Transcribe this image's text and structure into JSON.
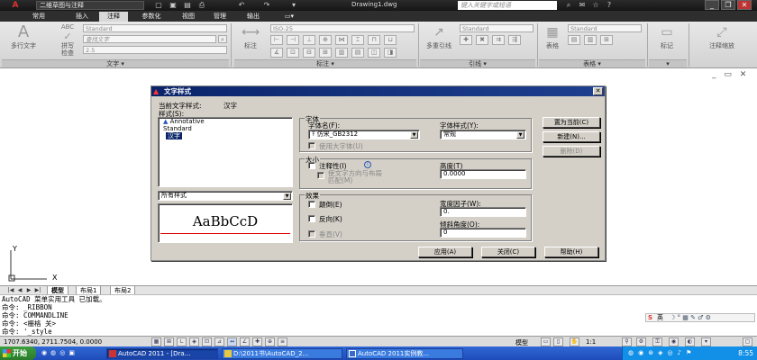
{
  "titlebar": {
    "app_button": "A",
    "workspace": "二维草图与注释",
    "quick_access": [
      "▢",
      "▣",
      "▤",
      "⎙",
      "↶",
      "↷",
      "▾"
    ],
    "document_title": "Drawing1.dwg",
    "search_placeholder": "键入关键字或短语",
    "window_controls": [
      "_",
      "❐",
      "✕"
    ]
  },
  "ribbon_tabs": [
    "常用",
    "插入",
    "注释",
    "参数化",
    "视图",
    "管理",
    "输出",
    "▭▾"
  ],
  "ribbon_active_tab": "注释",
  "ribbon": {
    "text_panel": {
      "big_button": "多行文字",
      "abc_label": "ABC",
      "spell_check": "拼写\n检查",
      "style_combo": "Standard",
      "find_text": "查找文字",
      "height_combo": "2.5",
      "panel_label": "文字 ▾"
    },
    "dim_panel": {
      "mark_label": "标注",
      "style_combo": "ISO-25",
      "panel_label": "标注 ▾"
    },
    "leader_panel": {
      "big_button": "多重引线",
      "style_combo": "Standard",
      "panel_label": "引线 ▾"
    },
    "table_panel": {
      "big_button": "表格",
      "style_combo": "Standard",
      "panel_label": "表格 ▾"
    },
    "markup_panel": {
      "big_button": "标记",
      "panel_label": "▾"
    },
    "scale_panel": {
      "big_button": "注释缩放"
    }
  },
  "dialog": {
    "title": "文字样式",
    "close": "✕",
    "current_style_label": "当前文字样式:",
    "current_style_value": "汉字",
    "styles_label": "样式(S):",
    "styles": [
      "Annotative",
      "Standard",
      "汉字"
    ],
    "selected_style_index": 2,
    "filter_value": "所有样式",
    "preview_text": "AaBbCcD",
    "font_group": "字体",
    "font_name_label": "字体名(F):",
    "font_name_value": "仿宋_GB2312",
    "font_style_label": "字体样式(Y):",
    "font_style_value": "常规",
    "big_font_label": "使用大字体(U)",
    "size_group": "大小",
    "annotative_label": "注释性(I)",
    "match_layout_label": "使文字方向与布局\n匹配(M)",
    "height_label": "高度(T)",
    "height_value": "0.0000",
    "effects_group": "效果",
    "upside_down_label": "颠倒(E)",
    "backwards_label": "反向(K)",
    "vertical_label": "垂直(V)",
    "width_factor_label": "宽度因子(W):",
    "width_factor_value": "0.",
    "oblique_label": "倾斜角度(O):",
    "oblique_value": "0",
    "set_current_button": "置为当前(C)",
    "new_button": "新建(N)...",
    "delete_button": "删除(D)",
    "apply_button": "应用(A)",
    "close_button": "关闭(C)",
    "help_button": "帮助(H)"
  },
  "layout_tabs": {
    "nav": [
      "|◀",
      "◀",
      "▶",
      "▶|"
    ],
    "tabs": [
      "模型",
      "布局1",
      "布局2"
    ],
    "active": "模型"
  },
  "ucs": {
    "y": "Y",
    "x": "X"
  },
  "command_lines": [
    "AutoCAD 菜单实用工具 已加载。",
    "命令: _RIBBON",
    "命令: COMMANDLINE",
    "命令: <栅格 关>",
    "命令: '_style"
  ],
  "ime_bar": {
    "text": "英",
    "icons": "☽ ° ▦ ✎ ♂ ⚙"
  },
  "status": {
    "coords": "1707.6340, 2711.7504, 0.0000",
    "model_label": "模型",
    "scale": "1:1",
    "icons_left": [
      "▦",
      "⊞",
      "∟",
      "◈",
      "⊡",
      "⊿",
      "↔",
      "∠",
      "✚",
      "⊕",
      "≡"
    ]
  },
  "taskbar": {
    "start": "开始",
    "buttons": [
      "AutoCAD 2011 - [Dra...",
      "D:\\2011书\\AutoCAD_2...",
      "AutoCAD 2011实例教..."
    ],
    "clock": "8:55"
  }
}
